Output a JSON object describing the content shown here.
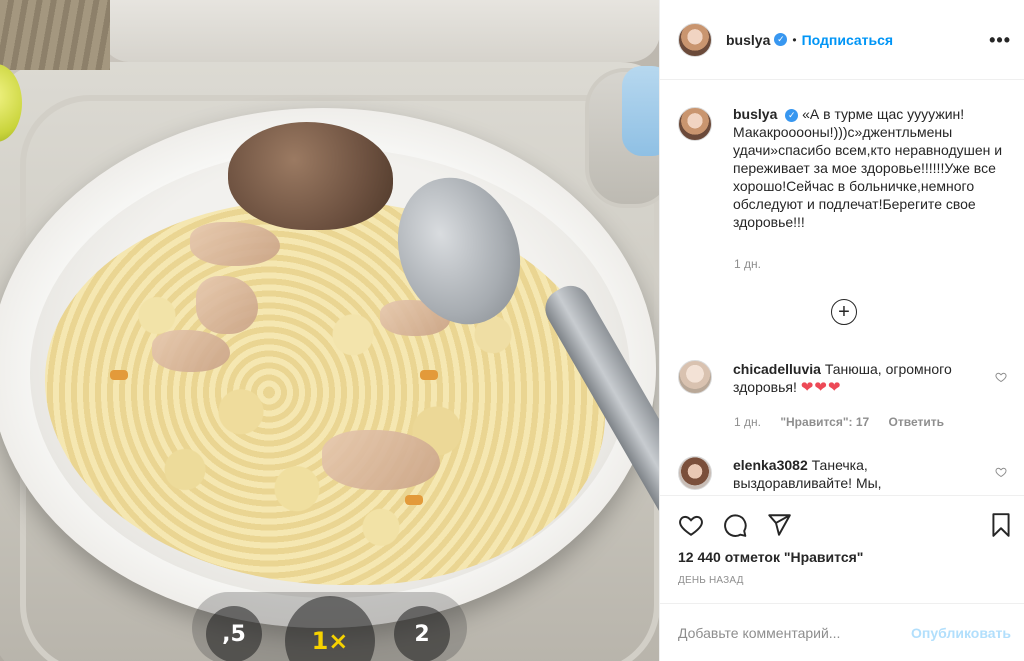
{
  "post": {
    "zoom": {
      "options": [
        ",5",
        "1×",
        "2"
      ],
      "active_index": 1
    }
  },
  "header": {
    "username": "buslya",
    "verified": true,
    "separator": "•",
    "follow_label": "Подписаться",
    "more_icon": "more-dots-icon"
  },
  "caption": {
    "username": "buslya",
    "text": "«А в турме щас уууужин! Макакрооооны!)))с»джентльмены удачи»спасибо всем,кто неравнодушен и переживает за мое здоровье!!!!!!Уже все хорошо!Сейчас в больничке,немного обследуют и подлечат!Берегите свое здоровье!!!",
    "time": "1 дн."
  },
  "load_more_icon": "plus-circle-icon",
  "comments": [
    {
      "username": "chicadelluvia",
      "text": "Танюша, огромного здоровья!",
      "emoji": "❤️❤️❤️",
      "time": "1 дн.",
      "likes": "\"Нравится\": 17",
      "reply_label": "Ответить"
    },
    {
      "username": "elenka3082",
      "text": "Танечка, выздоравливайте! Мы,"
    }
  ],
  "actions": {
    "likes_text": "12 440 отметок \"Нравится\"",
    "date_text": "ДЕНЬ НАЗАД",
    "comment_placeholder": "Добавьте комментарий...",
    "publish_label": "Опубликовать"
  },
  "colors": {
    "accent": "#0095f6",
    "verified": "#3897f0",
    "heart_red": "#ed4956",
    "publish_disabled": "#b2dffc",
    "muted": "#8e8e8e"
  }
}
